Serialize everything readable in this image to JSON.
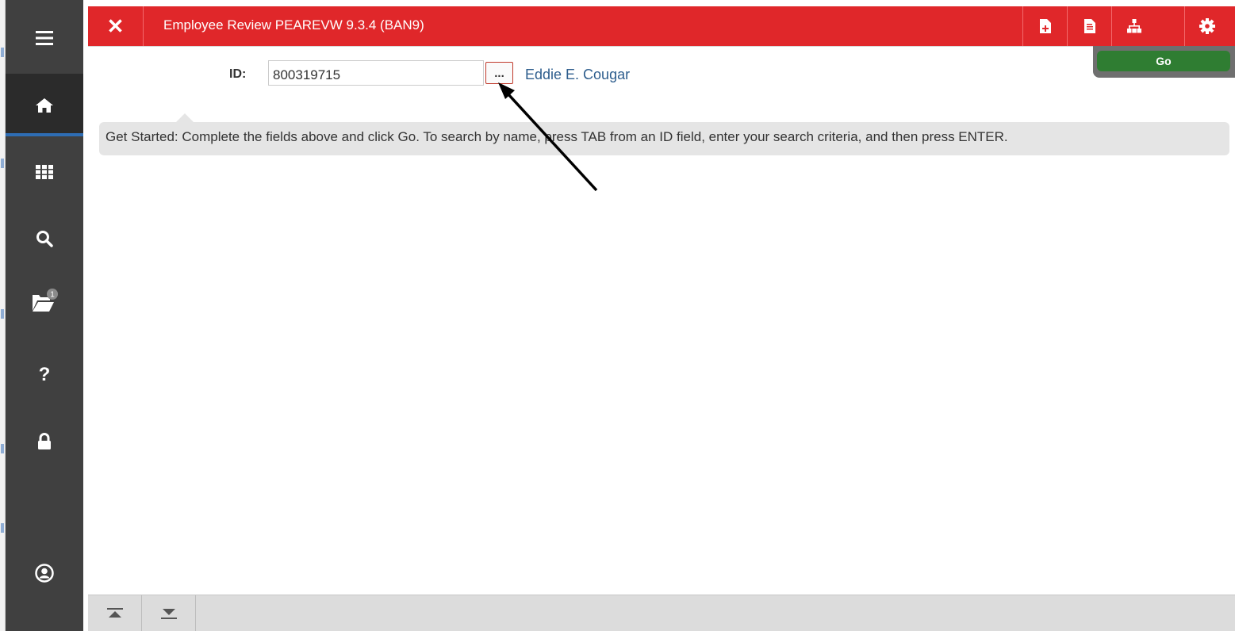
{
  "window": {
    "title": "Employee Review PEAREVW 9.3.4 (BAN9)",
    "accent_color": "#e0272a",
    "close_icon": "close-icon",
    "toolbar_icons": [
      "add-document-icon",
      "related-document-icon",
      "hierarchy-icon",
      "settings-gear-icon"
    ]
  },
  "sidebar": {
    "items": [
      {
        "name": "menu",
        "icon": "hamburger-icon"
      },
      {
        "name": "home",
        "icon": "home-icon"
      },
      {
        "name": "applications",
        "icon": "grid-icon"
      },
      {
        "name": "search",
        "icon": "search-icon"
      },
      {
        "name": "recently-opened",
        "icon": "folder-open-icon",
        "badge": "1"
      },
      {
        "name": "help",
        "icon": "question-icon"
      },
      {
        "name": "sign-out",
        "icon": "lock-icon"
      },
      {
        "name": "user-profile",
        "icon": "user-circle-icon"
      }
    ]
  },
  "key_block": {
    "id_label": "ID:",
    "id_value": "800319715",
    "lookup_label": "...",
    "employee_name": "Eddie E. Cougar",
    "go_label": "Go",
    "go_color": "#2f7d32"
  },
  "notice": {
    "text": "Get Started: Complete the fields above and click Go. To search by name, press TAB from an ID field, enter your search criteria, and then press ENTER."
  },
  "bottom_bar": {
    "icons": [
      "first-record-icon",
      "last-record-icon"
    ]
  }
}
